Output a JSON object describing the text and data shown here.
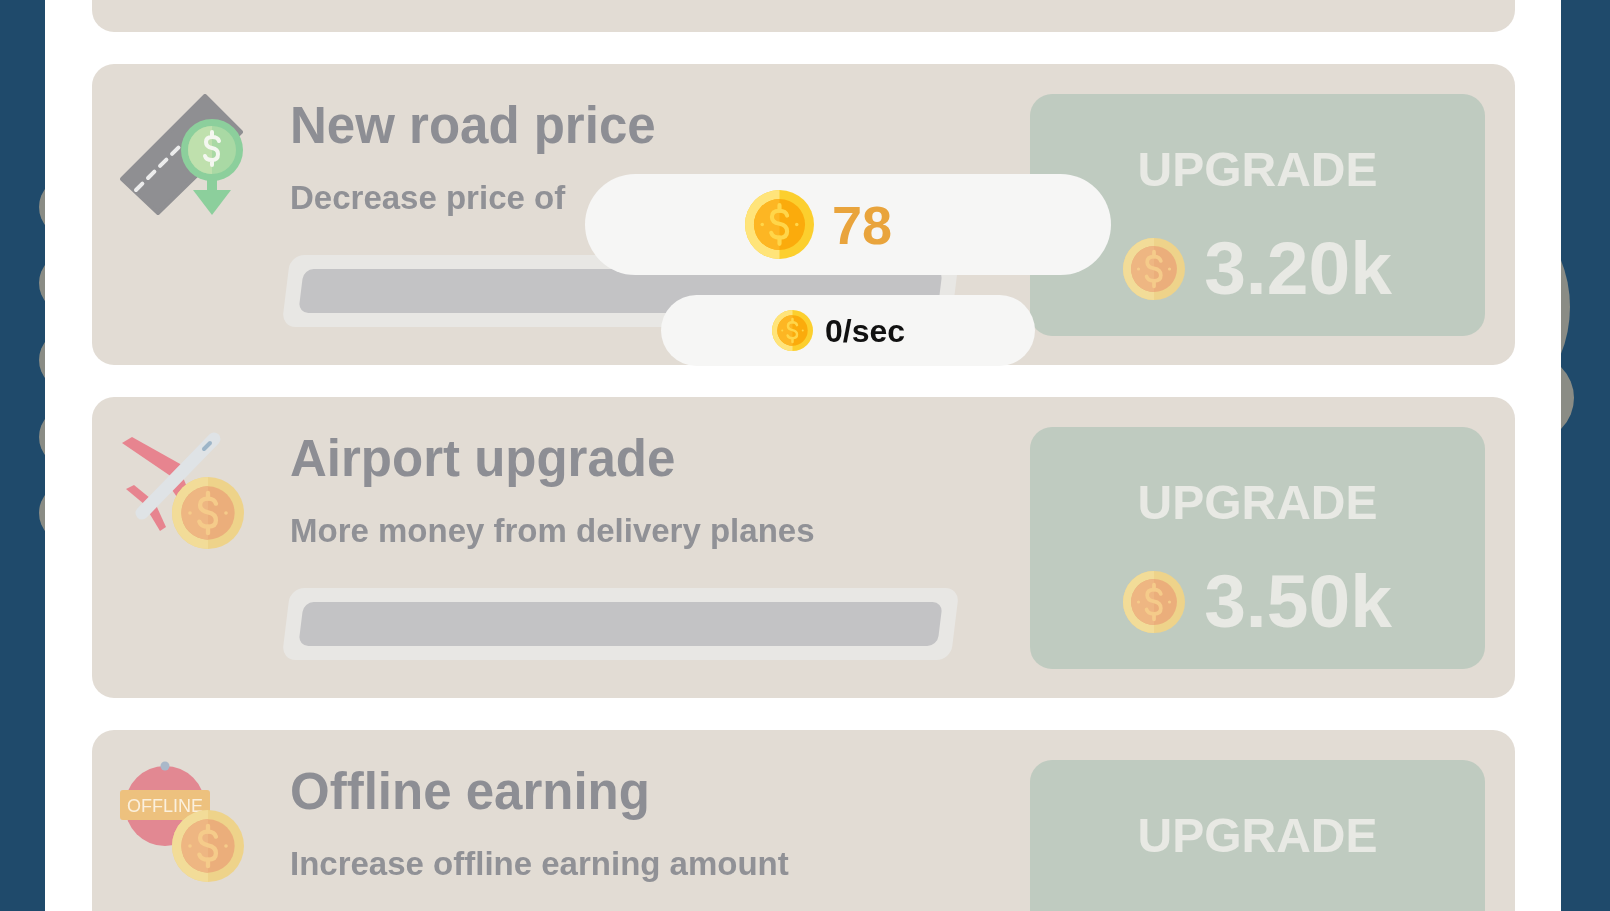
{
  "balance": {
    "amount": "78",
    "rate": "0/sec"
  },
  "upgrades": [
    {
      "kind": "road",
      "title": "New road price",
      "description": "Decrease price of",
      "level": 0,
      "button": {
        "label": "UPGRADE",
        "price": "3.20k"
      }
    },
    {
      "kind": "plane",
      "title": "Airport upgrade",
      "description": "More money from delivery planes",
      "level": 0,
      "button": {
        "label": "UPGRADE",
        "price": "3.50k"
      }
    },
    {
      "kind": "offline",
      "icon_text": "OFFLINE",
      "title": "Offline earning",
      "description": "Increase offline earning amount",
      "button": {
        "label": "UPGRADE"
      }
    }
  ]
}
